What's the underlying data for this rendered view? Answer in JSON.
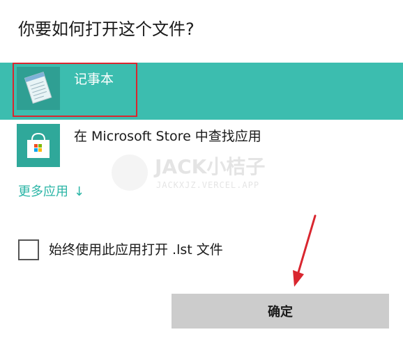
{
  "dialog": {
    "title": "你要如何打开这个文件?"
  },
  "apps": [
    {
      "label": "记事本",
      "icon": "notepad-icon",
      "selected": true
    },
    {
      "label": "在 Microsoft Store 中查找应用",
      "icon": "store-icon",
      "selected": false
    }
  ],
  "more_apps": {
    "label": "更多应用",
    "arrow": "↓"
  },
  "always_use": {
    "label": "始终使用此应用打开 .lst 文件",
    "checked": false
  },
  "ok_button": {
    "label": "确定"
  },
  "watermark": {
    "title": "JACK小桔子",
    "subtitle": "JACKXJZ.VERCEL.APP"
  },
  "colors": {
    "accent": "#3cbdaf",
    "highlight_border": "#d9262f",
    "link": "#2bb5a6",
    "button_bg": "#cccccc"
  }
}
